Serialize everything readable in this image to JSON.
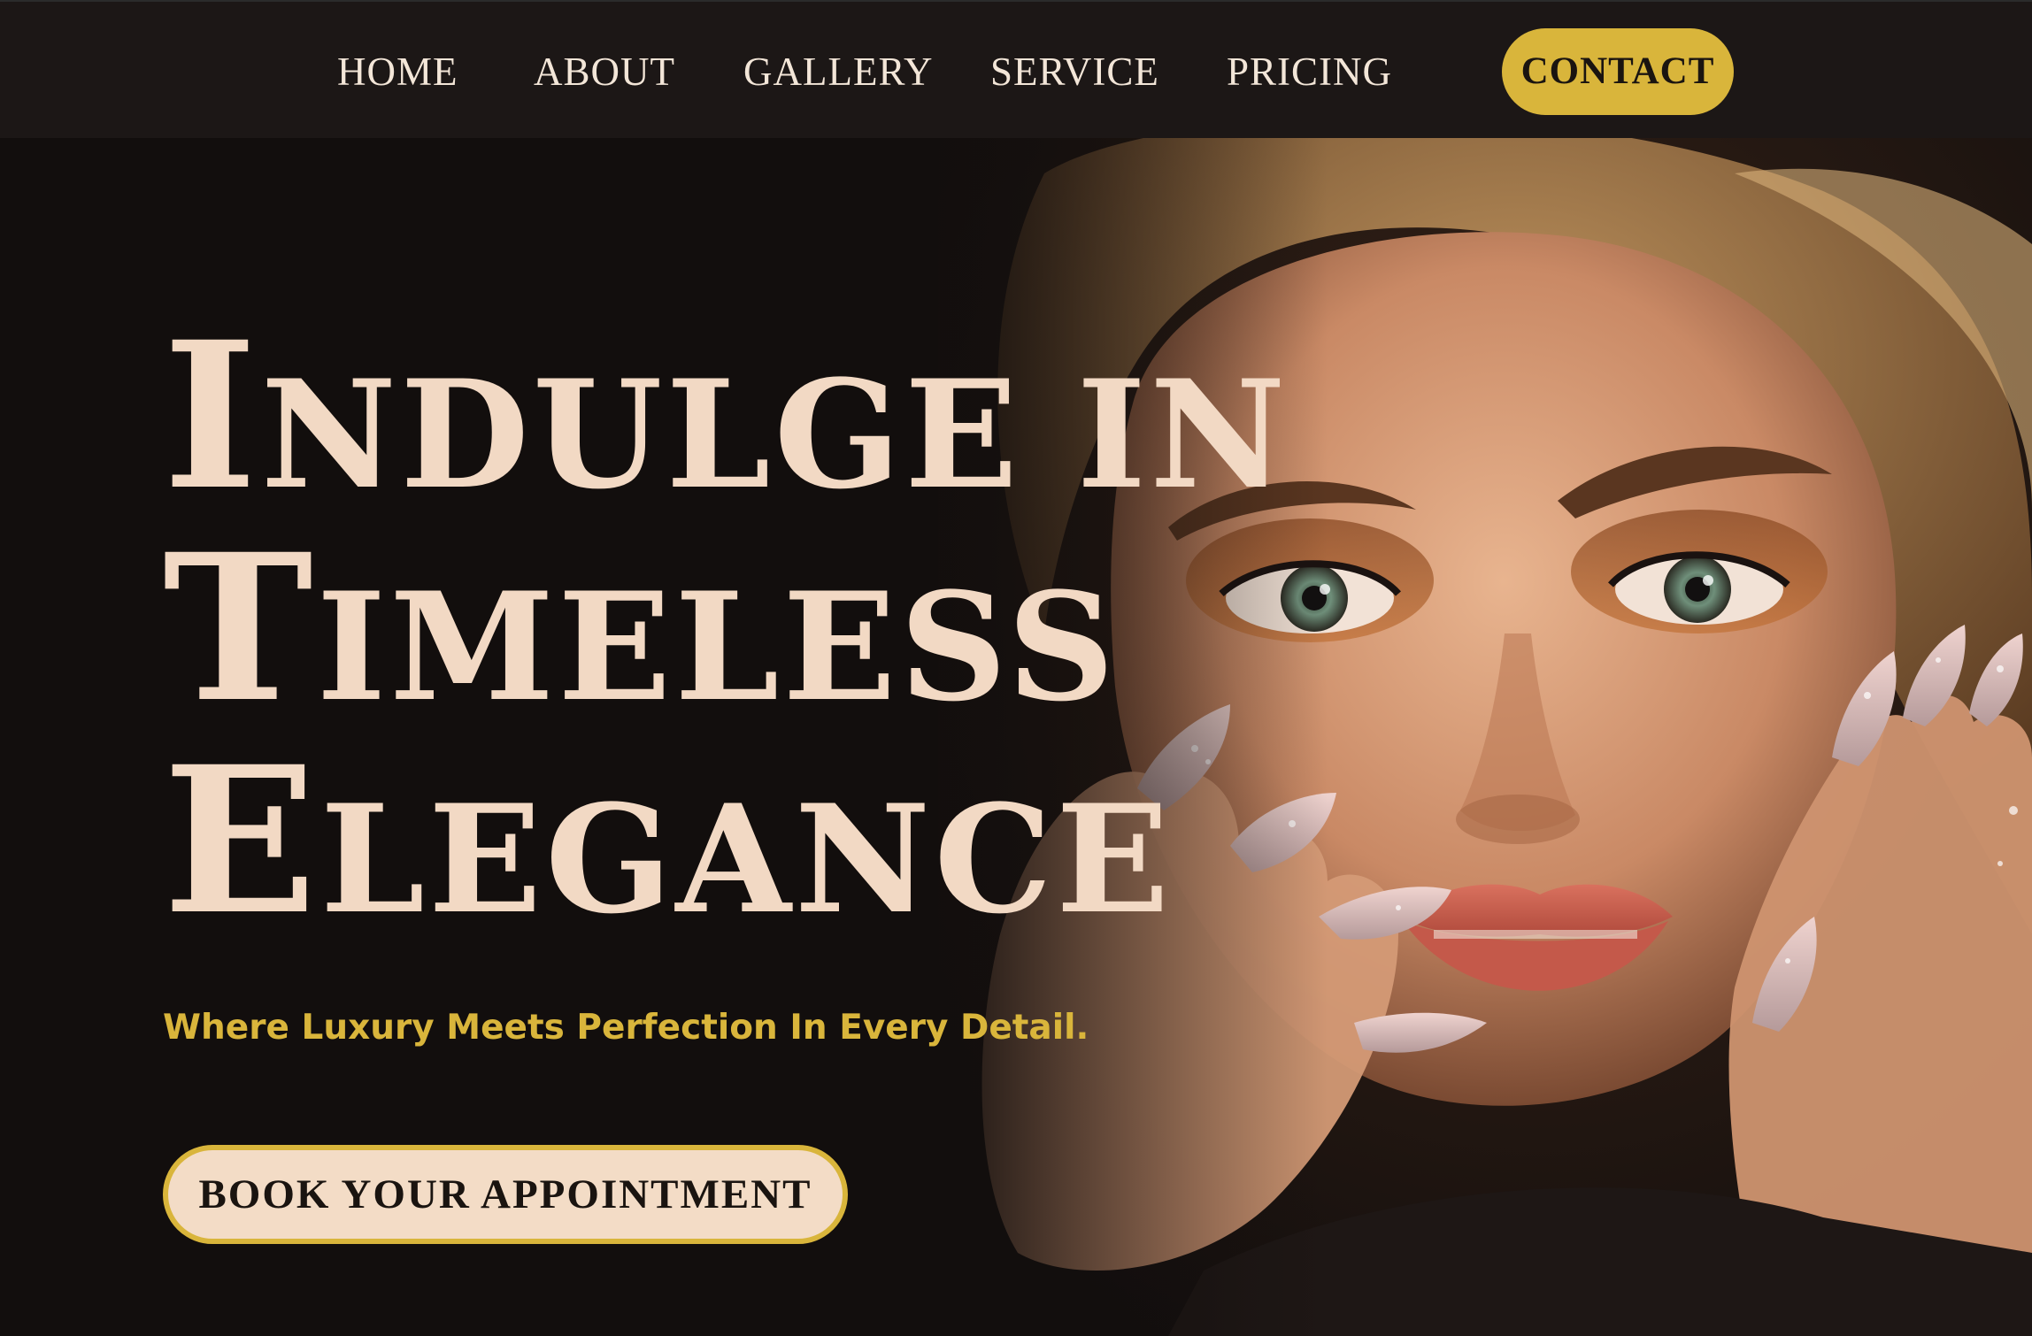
{
  "nav": {
    "home": "HOME",
    "about": "ABOUT",
    "gallery": "GALLERY",
    "service": "SERVICE",
    "pricing": "PRICING",
    "contact": "CONTACT"
  },
  "hero": {
    "headline_lines": [
      {
        "cap": "I",
        "rest": "NDULGE IN"
      },
      {
        "cap": "T",
        "rest": "IMELESS"
      },
      {
        "cap": "E",
        "rest": "LEGANCE"
      }
    ],
    "tagline": "Where Luxury Meets Perfection In Every Detail.",
    "cta": "BOOK YOUR APPOINTMENT",
    "image": "woman-portrait-with-jeweled-nails"
  },
  "colors": {
    "background": "#120e0d",
    "navbar": "#1c1716",
    "accent_gold": "#d9b53b",
    "headline_cream": "#f2d9c4",
    "nav_text": "#f3e6d8"
  }
}
